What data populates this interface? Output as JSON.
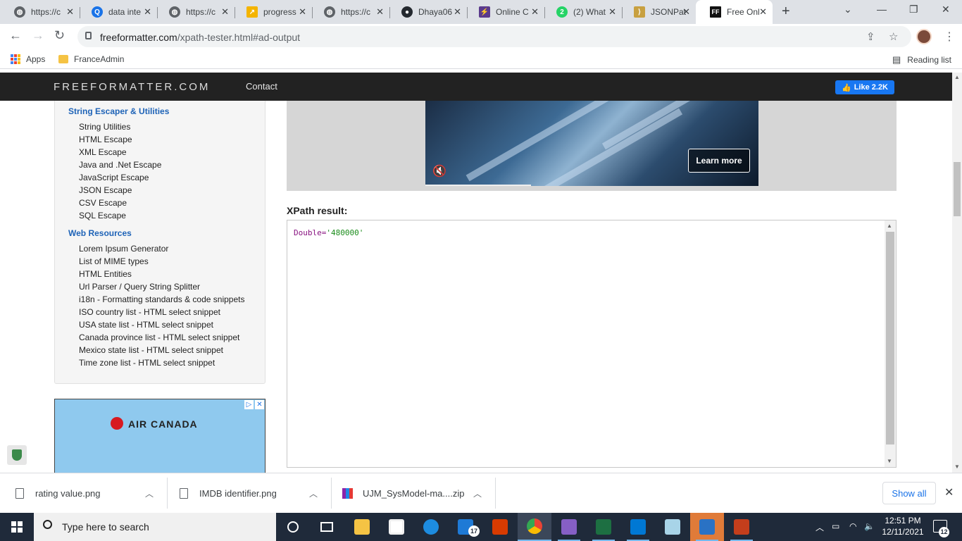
{
  "browser": {
    "tabs": [
      {
        "title": "https://c",
        "icon": "globe-icon"
      },
      {
        "title": "data inte",
        "icon": "quillbot-icon"
      },
      {
        "title": "https://c",
        "icon": "globe-icon"
      },
      {
        "title": "progress",
        "icon": "progress-icon"
      },
      {
        "title": "https://c",
        "icon": "globe-icon"
      },
      {
        "title": "Dhaya06",
        "icon": "github-icon"
      },
      {
        "title": "Online C",
        "icon": "bolt-icon"
      },
      {
        "title": "(2) What",
        "icon": "whatsapp-icon"
      },
      {
        "title": "JSONPat",
        "icon": "jsonpath-icon"
      },
      {
        "title": "Free Onl",
        "icon": "freeformatter-icon"
      }
    ],
    "url_domain": "freeformatter.com",
    "url_path": "/xpath-tester.html#ad-output",
    "bookmarks": {
      "apps": "Apps",
      "folder": "FranceAdmin",
      "reading_list": "Reading list"
    }
  },
  "site": {
    "brand": "FREEFORMATTER.COM",
    "nav_contact": "Contact",
    "fb_like": "Like 2.2K"
  },
  "sidebar": {
    "section1_title": "String Escaper & Utilities",
    "section1_items": [
      "String Utilities",
      "HTML Escape",
      "XML Escape",
      "Java and .Net Escape",
      "JavaScript Escape",
      "JSON Escape",
      "CSV Escape",
      "SQL Escape"
    ],
    "section2_title": "Web Resources",
    "section2_items": [
      "Lorem Ipsum Generator",
      "List of MIME types",
      "HTML Entities",
      "Url Parser / Query String Splitter",
      "i18n - Formatting standards & code snippets",
      "ISO country list - HTML select snippet",
      "USA state list - HTML select snippet",
      "Canada province list - HTML select snippet",
      "Mexico state list - HTML select snippet",
      "Time zone list - HTML select snippet"
    ]
  },
  "ads": {
    "banner_button": "Learn more",
    "left_ad_brand": "AIR CANADA"
  },
  "result": {
    "label": "XPath result:",
    "key": "Double=",
    "value": "'480000'"
  },
  "downloads": {
    "items": [
      "rating value.png",
      "IMDB identifier.png",
      "UJM_SysModel-ma....zip"
    ],
    "show_all": "Show all"
  },
  "taskbar": {
    "search_placeholder": "Type here to search",
    "time": "12:51 PM",
    "date": "12/11/2021",
    "mail_badge": "17",
    "notification_count": "12"
  }
}
